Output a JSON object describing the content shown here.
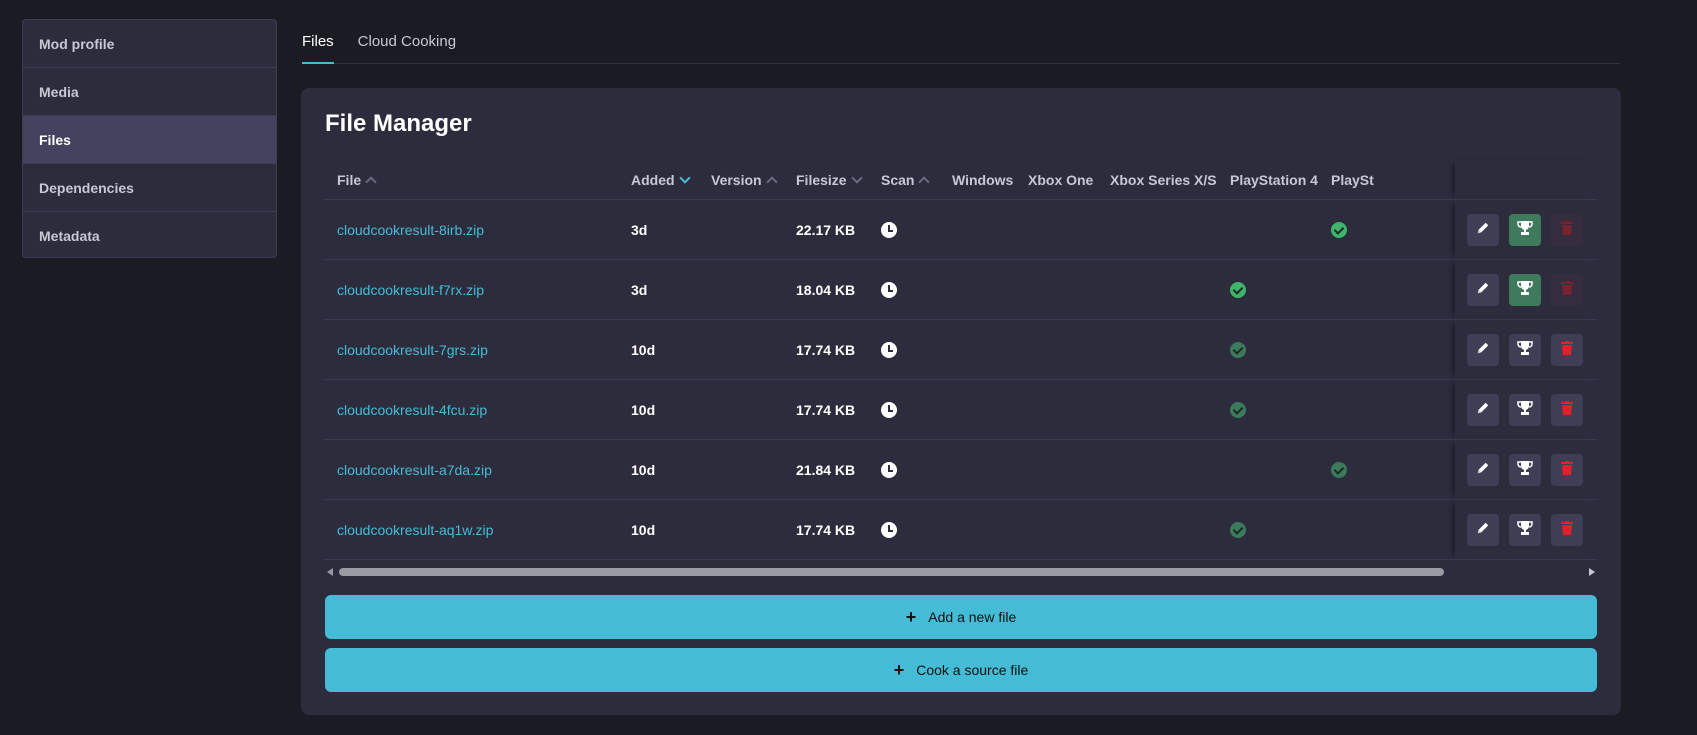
{
  "sidebar": {
    "items": [
      {
        "label": "Mod profile",
        "active": false
      },
      {
        "label": "Media",
        "active": false
      },
      {
        "label": "Files",
        "active": true
      },
      {
        "label": "Dependencies",
        "active": false
      },
      {
        "label": "Metadata",
        "active": false
      }
    ]
  },
  "tabs": [
    {
      "label": "Files",
      "active": true
    },
    {
      "label": "Cloud Cooking",
      "active": false
    }
  ],
  "file_manager": {
    "title": "File Manager",
    "columns": {
      "file": "File",
      "added": "Added",
      "version": "Version",
      "filesize": "Filesize",
      "scan": "Scan",
      "windows": "Windows",
      "xbox_one": "Xbox One",
      "xbox_series": "Xbox Series X/S",
      "ps4": "PlayStation 4",
      "ps5": "PlaySt"
    },
    "rows": [
      {
        "file": "cloudcookresult-8irb.zip",
        "added": "3d",
        "version": "",
        "filesize": "22.17 KB",
        "ps4": false,
        "ps5": true,
        "highlighted": true,
        "trophy_active": true,
        "delete_disabled": true
      },
      {
        "file": "cloudcookresult-f7rx.zip",
        "added": "3d",
        "version": "",
        "filesize": "18.04 KB",
        "ps4": true,
        "ps5": false,
        "highlighted": true,
        "trophy_active": true,
        "delete_disabled": true
      },
      {
        "file": "cloudcookresult-7grs.zip",
        "added": "10d",
        "version": "",
        "filesize": "17.74 KB",
        "ps4": true,
        "ps5": false,
        "highlighted": false,
        "trophy_active": false,
        "delete_disabled": false
      },
      {
        "file": "cloudcookresult-4fcu.zip",
        "added": "10d",
        "version": "",
        "filesize": "17.74 KB",
        "ps4": true,
        "ps5": false,
        "highlighted": false,
        "trophy_active": false,
        "delete_disabled": false
      },
      {
        "file": "cloudcookresult-a7da.zip",
        "added": "10d",
        "version": "",
        "filesize": "21.84 KB",
        "ps4": false,
        "ps5": true,
        "highlighted": false,
        "trophy_active": false,
        "delete_disabled": false
      },
      {
        "file": "cloudcookresult-aq1w.zip",
        "added": "10d",
        "version": "",
        "filesize": "17.74 KB",
        "ps4": true,
        "ps5": false,
        "highlighted": false,
        "trophy_active": false,
        "delete_disabled": false
      }
    ],
    "add_file_label": "Add a new file",
    "cook_source_label": "Cook a source file"
  },
  "colors": {
    "accent": "#45bcd5",
    "background": "#1b1b24",
    "panel": "#2c2c3c",
    "success": "#3fb56b",
    "danger": "#e0202a"
  }
}
